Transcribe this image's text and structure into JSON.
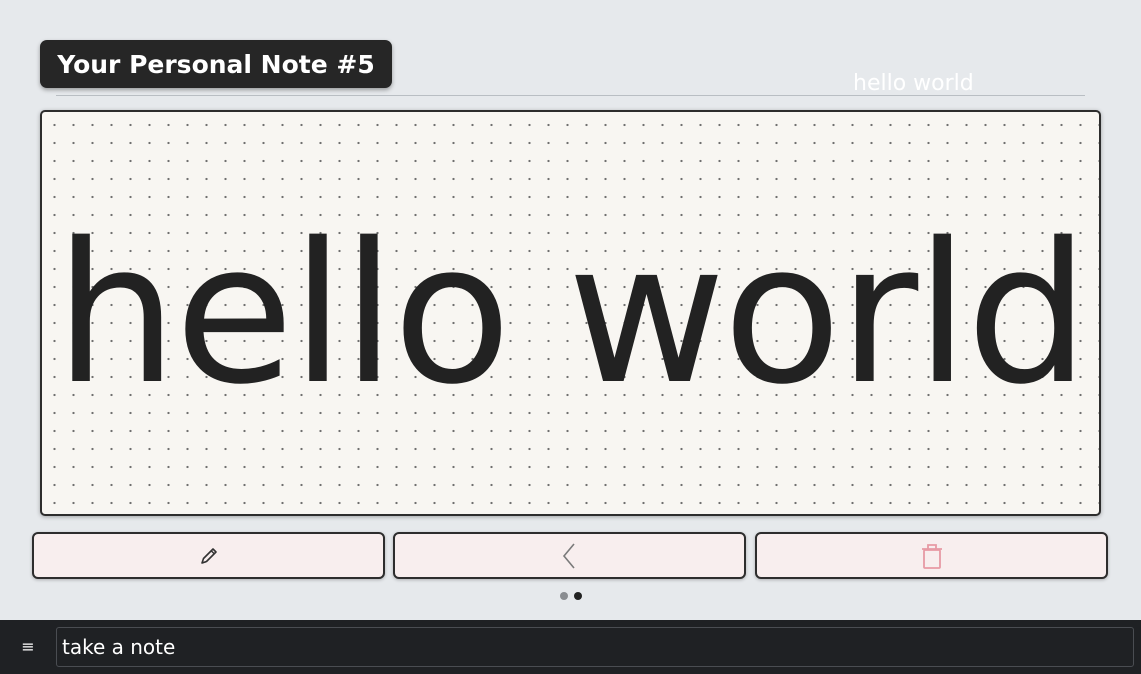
{
  "header": {
    "title": "Your Personal Note #5",
    "subtitle": "hello world"
  },
  "note": {
    "content": "hello world"
  },
  "actions": [
    {
      "icon": "pencil-icon",
      "label": "edit"
    },
    {
      "icon": "chevron-left-icon",
      "label": "back"
    },
    {
      "icon": "trash-icon",
      "label": "delete"
    }
  ],
  "pager": {
    "total": 2,
    "active_index": 1
  },
  "bottom_bar": {
    "menu_icon": "≡",
    "input_placeholder": "take a note"
  },
  "colors": {
    "background": "#e6e9ec",
    "badge": "#262626",
    "card": "#f8f6f2",
    "button_bg": "#f8eeee",
    "trash_accent": "#e79aa4",
    "bottom_bar": "#1f2124"
  }
}
